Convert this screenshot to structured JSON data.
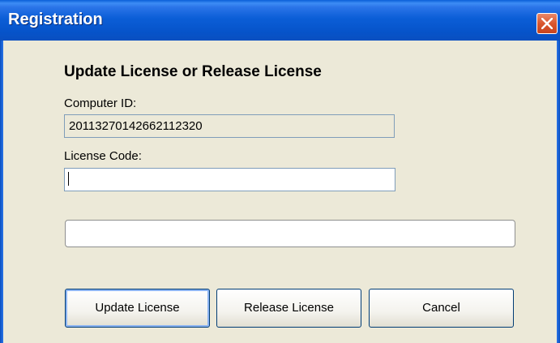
{
  "window": {
    "title": "Registration"
  },
  "form": {
    "heading": "Update License or Release License",
    "computer_id_label": "Computer ID:",
    "computer_id_value": "20113270142662112320",
    "license_code_label": "License Code:",
    "license_code_value": "",
    "status_value": ""
  },
  "buttons": {
    "update": "Update License",
    "release": "Release License",
    "cancel": "Cancel"
  },
  "colors": {
    "title_bar": "#0653C9",
    "dialog_bg": "#ECE9D8",
    "close_button": "#D9572F",
    "field_border": "#7F9DB9"
  },
  "icons": {
    "close": "close-icon"
  }
}
